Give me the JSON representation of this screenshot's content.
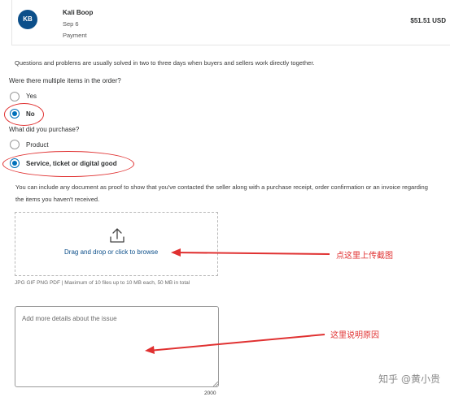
{
  "transaction": {
    "avatar_initials": "KB",
    "merchant": "Kali Boop",
    "date": "Sep 6",
    "type": "Payment",
    "amount": "$51.51 USD"
  },
  "info_text": "Questions and problems are usually solved in two to three days when buyers and sellers work directly together.",
  "question_multiple": {
    "label": "Were there multiple items in the order?",
    "options": [
      {
        "label": "Yes",
        "selected": false
      },
      {
        "label": "No",
        "selected": true
      }
    ]
  },
  "question_purchase": {
    "label": "What did you purchase?",
    "options": [
      {
        "label": "Product",
        "selected": false
      },
      {
        "label": "Service, ticket or digital good",
        "selected": true
      }
    ]
  },
  "proof_note": "You can include any document as proof to show that you've contacted the seller along with a purchase receipt, order confirmation or an invoice regarding the items you haven't received.",
  "upload": {
    "icon": "upload-icon",
    "browse_text": "Drag and drop or click to browse",
    "file_hint": "JPG GIF PNG PDF | Maximum of 10 files up to 10 MB each, 50 MB in total"
  },
  "details": {
    "placeholder": "Add more details about the issue",
    "char_limit": "2000"
  },
  "annotations": {
    "upload_note": "点这里上传截图",
    "details_note": "这里说明原因",
    "watermark": "知乎 @黄小贵",
    "color": "#e03131"
  },
  "colors": {
    "accent": "#0070ba",
    "avatar_bg": "#0c4f8a"
  }
}
